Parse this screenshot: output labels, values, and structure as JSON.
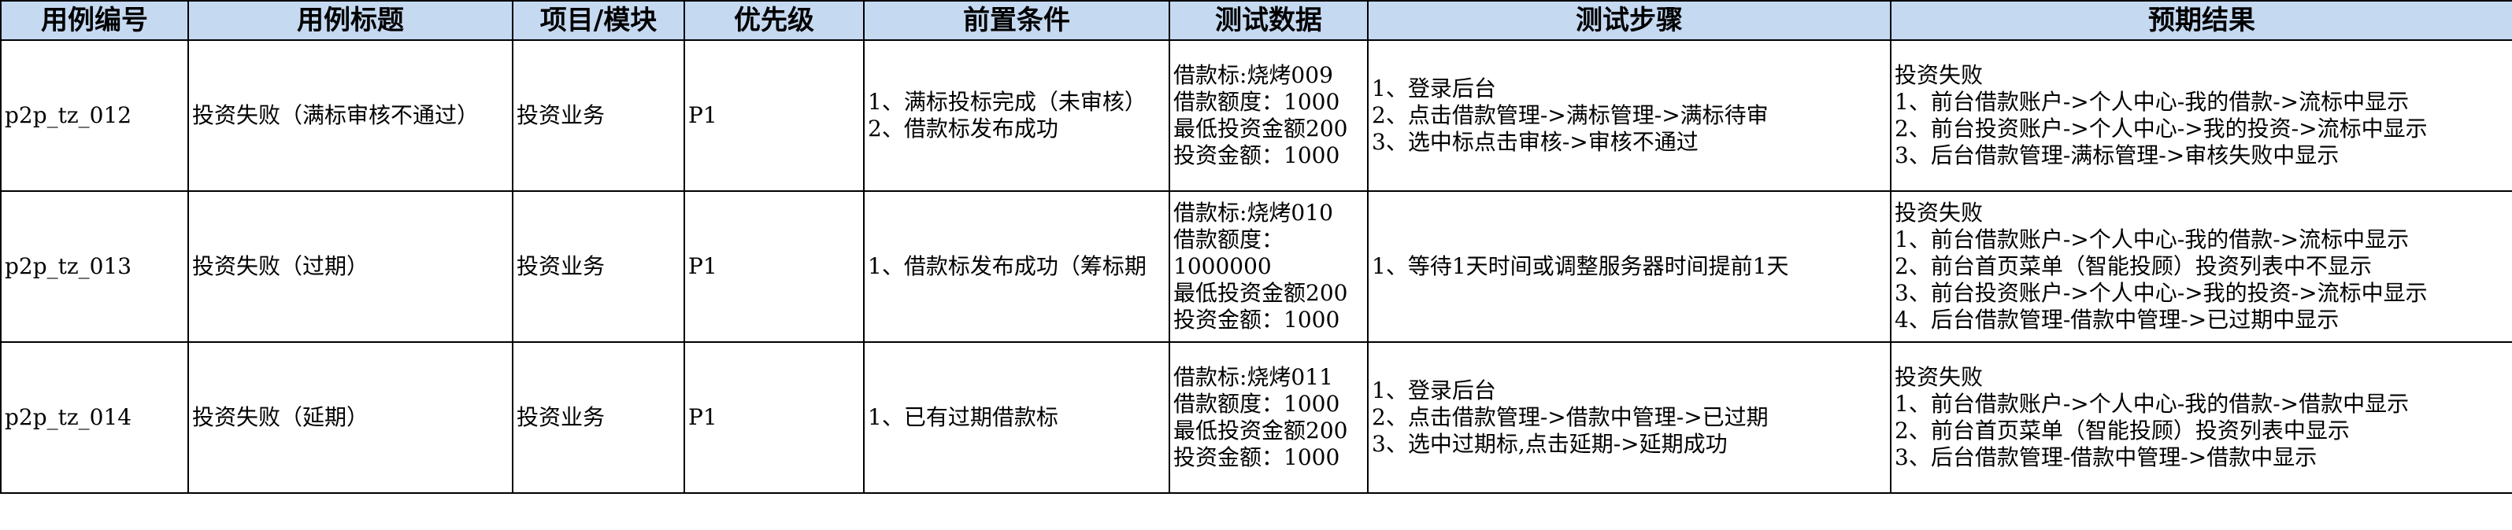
{
  "headers": [
    "用例编号",
    "用例标题",
    "项目/模块",
    "优先级",
    "前置条件",
    "测试数据",
    "测试步骤",
    "预期结果"
  ],
  "rows": [
    {
      "id": "p2p_tz_012",
      "title": "投资失败（满标审核不通过）",
      "module": "投资业务",
      "priority": "P1",
      "precondition": "1、满标投标完成（未审核）\n2、借款标发布成功",
      "data": "借款标:烧烤009\n借款额度：1000\n最低投资金额200\n投资金额：1000",
      "steps": "1、登录后台\n2、点击借款管理->满标管理->满标待审\n3、选中标点击审核->审核不通过",
      "expected": "投资失败\n1、前台借款账户->个人中心-我的借款->流标中显示\n2、前台投资账户->个人中心->我的投资->流标中显示\n3、后台借款管理-满标管理->审核失败中显示"
    },
    {
      "id": "p2p_tz_013",
      "title": "投资失败（过期）",
      "module": "投资业务",
      "priority": "P1",
      "precondition": "1、借款标发布成功（筹标期",
      "data": "借款标:烧烤010\n借款额度：\n1000000\n最低投资金额200\n投资金额：1000",
      "steps": "1、等待1天时间或调整服务器时间提前1天",
      "expected": "投资失败\n1、前台借款账户->个人中心-我的借款->流标中显示\n2、前台首页菜单（智能投顾）投资列表中不显示\n3、前台投资账户->个人中心->我的投资->流标中显示\n4、后台借款管理-借款中管理->已过期中显示"
    },
    {
      "id": "p2p_tz_014",
      "title": "投资失败（延期）",
      "module": "投资业务",
      "priority": "P1",
      "precondition": "1、已有过期借款标",
      "data": "借款标:烧烤011\n借款额度：1000\n最低投资金额200\n投资金额：1000",
      "steps": "1、登录后台\n2、点击借款管理->借款中管理->已过期\n3、选中过期标,点击延期->延期成功",
      "expected": "投资失败\n1、前台借款账户->个人中心-我的借款->借款中显示\n2、前台首页菜单（智能投顾）投资列表中显示\n3、后台借款管理-借款中管理->借款中显示"
    }
  ]
}
